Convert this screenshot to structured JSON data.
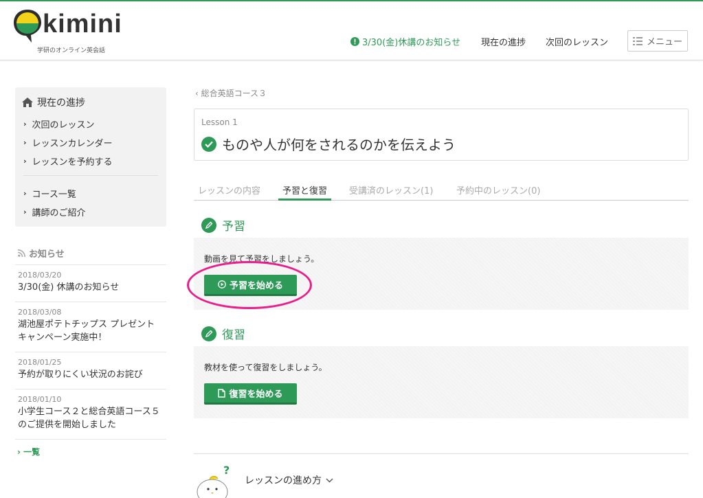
{
  "brand": {
    "name": "kimini",
    "tagline": "学研のオンライン英会話",
    "accent": "#2e9a57",
    "highlight": "#e91e8c"
  },
  "header": {
    "notice": "3/30(金)休講のお知らせ",
    "notice_icon": "exclamation-circle-icon",
    "progress": "現在の進捗",
    "next_lesson": "次回のレッスン",
    "menu": "メニュー",
    "menu_icon": "list-icon"
  },
  "sidebar": {
    "title": "現在の進捗",
    "title_icon": "home-icon",
    "items": [
      "次回のレッスン",
      "レッスンカレンダー",
      "レッスンを予約する"
    ],
    "items2": [
      "コース一覧",
      "講師のご紹介"
    ]
  },
  "news": {
    "heading": "お知らせ",
    "heading_icon": "rss-icon",
    "items": [
      {
        "date": "2018/03/20",
        "title": "3/30(金) 休講のお知らせ"
      },
      {
        "date": "2018/03/08",
        "title": "湖池屋ポテトチップス プレゼントキャンペーン実施中！"
      },
      {
        "date": "2018/01/25",
        "title": "予約が取りにくい状況のお詫び"
      },
      {
        "date": "2018/01/10",
        "title": "小学生コース２と総合英語コース５のご提供を開始しました"
      }
    ],
    "more": "一覧"
  },
  "main": {
    "breadcrumb": "総合英語コース３",
    "lesson_number": "Lesson 1",
    "lesson_title": "ものや人が何をされるのかを伝えよう",
    "tabs": [
      "レッスンの内容",
      "予習と復習",
      "受講済のレッスン(1)",
      "予約中のレッスン(0)"
    ],
    "active_tab": "予習と復習",
    "preview": {
      "heading": "予習",
      "text": "動画を見て予習をしましょう。",
      "button": "予習を始める",
      "button_icon": "play-circle-icon"
    },
    "review": {
      "heading": "復習",
      "text": "教材を使って復習をしましょう。",
      "button": "復習を始める",
      "button_icon": "document-icon"
    },
    "howto": "レッスンの進め方"
  }
}
